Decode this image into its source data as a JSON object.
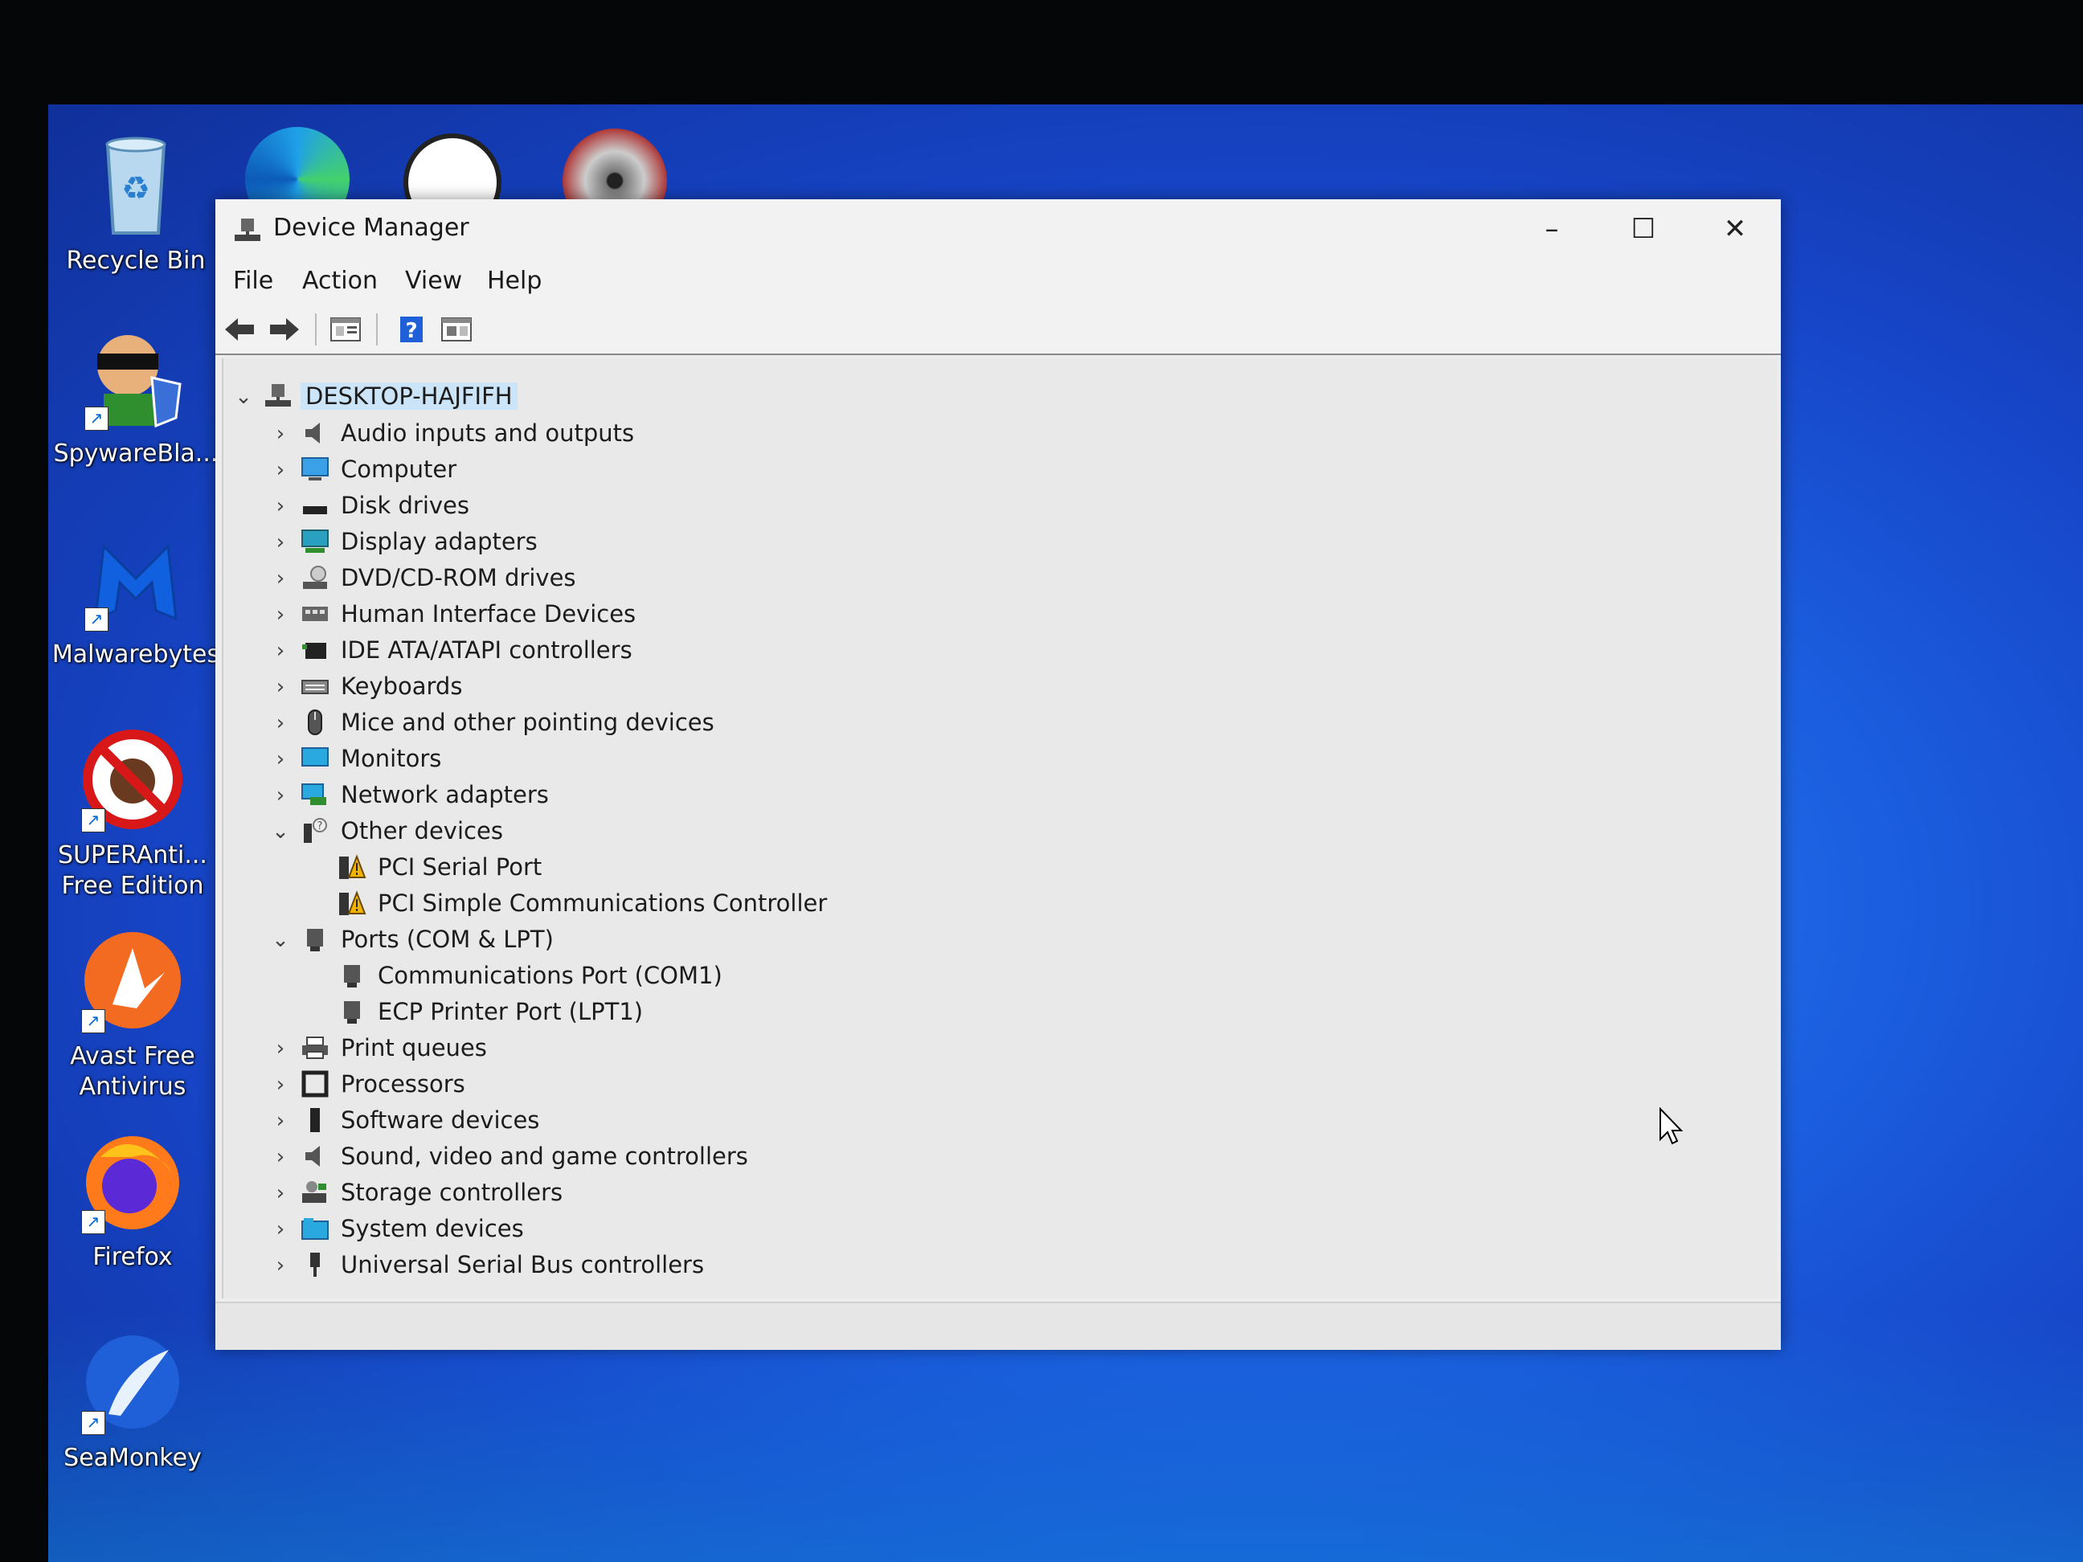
{
  "desktop": {
    "icons": [
      {
        "label": "Recycle Bin",
        "icon": "recycle-bin-icon"
      },
      {
        "label": "SpywareBla...",
        "icon": "spywareblaster-icon"
      },
      {
        "label": "Malwarebytes",
        "icon": "malwarebytes-icon"
      },
      {
        "label": "SUPERAnti...\nFree Edition",
        "icon": "superantispyware-icon"
      },
      {
        "label": "Avast Free\nAntivirus",
        "icon": "avast-icon"
      },
      {
        "label": "Firefox",
        "icon": "firefox-icon"
      },
      {
        "label": "SeaMonkey",
        "icon": "seamonkey-icon"
      }
    ]
  },
  "window": {
    "title": "Device Manager",
    "controls": {
      "minimize": "–",
      "maximize": "☐",
      "close": "✕"
    }
  },
  "menu": [
    "File",
    "Action",
    "View",
    "Help"
  ],
  "tree": {
    "root": "DESKTOP-HAJFIFH",
    "items": [
      {
        "label": "Audio inputs and outputs",
        "expanded": false
      },
      {
        "label": "Computer",
        "expanded": false
      },
      {
        "label": "Disk drives",
        "expanded": false
      },
      {
        "label": "Display adapters",
        "expanded": false
      },
      {
        "label": "DVD/CD-ROM drives",
        "expanded": false
      },
      {
        "label": "Human Interface Devices",
        "expanded": false
      },
      {
        "label": "IDE ATA/ATAPI controllers",
        "expanded": false
      },
      {
        "label": "Keyboards",
        "expanded": false
      },
      {
        "label": "Mice and other pointing devices",
        "expanded": false
      },
      {
        "label": "Monitors",
        "expanded": false
      },
      {
        "label": "Network adapters",
        "expanded": false
      },
      {
        "label": "Other devices",
        "expanded": true,
        "children": [
          "PCI Serial Port",
          "PCI Simple Communications Controller"
        ]
      },
      {
        "label": "Ports (COM & LPT)",
        "expanded": true,
        "children": [
          "Communications Port (COM1)",
          "ECP Printer Port (LPT1)"
        ]
      },
      {
        "label": "Print queues",
        "expanded": false
      },
      {
        "label": "Processors",
        "expanded": false
      },
      {
        "label": "Software devices",
        "expanded": false
      },
      {
        "label": "Sound, video and game controllers",
        "expanded": false
      },
      {
        "label": "Storage controllers",
        "expanded": false
      },
      {
        "label": "System devices",
        "expanded": false
      },
      {
        "label": "Universal Serial Bus controllers",
        "expanded": false
      }
    ]
  },
  "colors": {
    "accent": "#0063b1",
    "selection": "#cce4f7",
    "warning": "#f2b200"
  }
}
